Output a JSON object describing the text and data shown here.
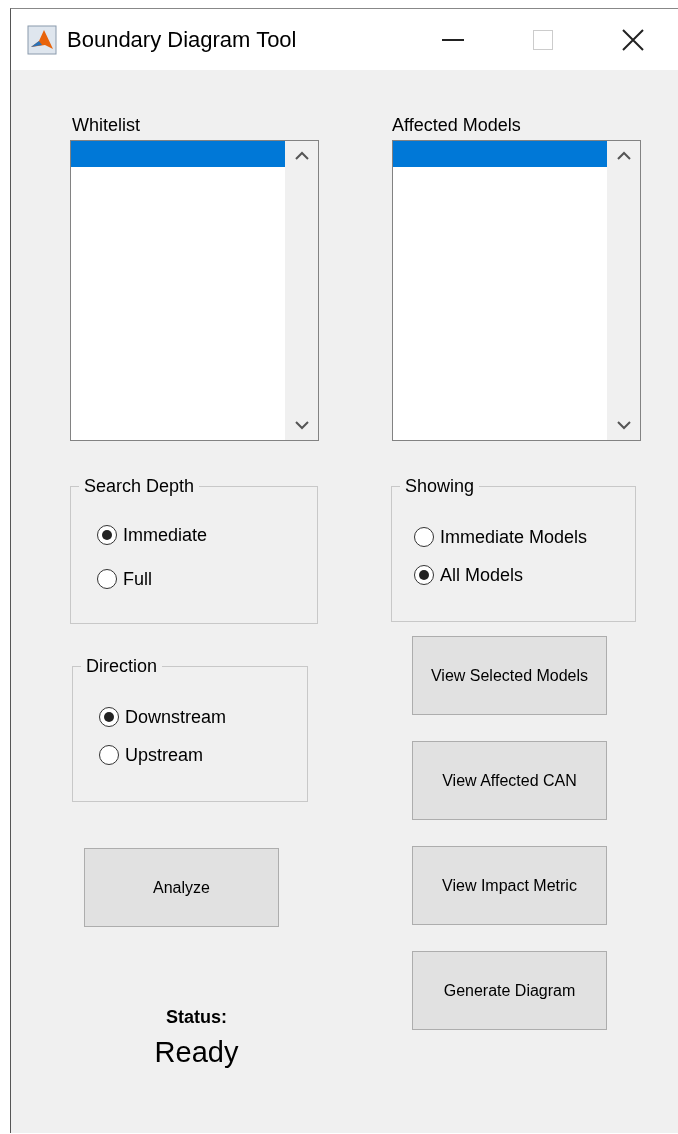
{
  "window": {
    "title": "Boundary Diagram Tool"
  },
  "lists": [
    {
      "label": "Whitelist",
      "items": [
        {
          "selected": true
        }
      ]
    },
    {
      "label": "Affected Models",
      "items": [
        {
          "selected": true
        }
      ]
    }
  ],
  "search_depth": {
    "title": "Search Depth",
    "options": [
      {
        "label": "Immediate",
        "selected": true
      },
      {
        "label": "Full",
        "selected": false
      }
    ]
  },
  "direction": {
    "title": "Direction",
    "options": [
      {
        "label": "Downstream",
        "selected": true
      },
      {
        "label": "Upstream",
        "selected": false
      }
    ]
  },
  "showing": {
    "title": "Showing",
    "options": [
      {
        "label": "Immediate Models",
        "selected": false
      },
      {
        "label": "All Models",
        "selected": true
      }
    ]
  },
  "analyze_button": "Analyze",
  "buttons": [
    "View Selected Models",
    "View Affected CAN",
    "View Impact Metric",
    "Generate Diagram"
  ],
  "status": {
    "label": "Status:",
    "value": "Ready"
  }
}
